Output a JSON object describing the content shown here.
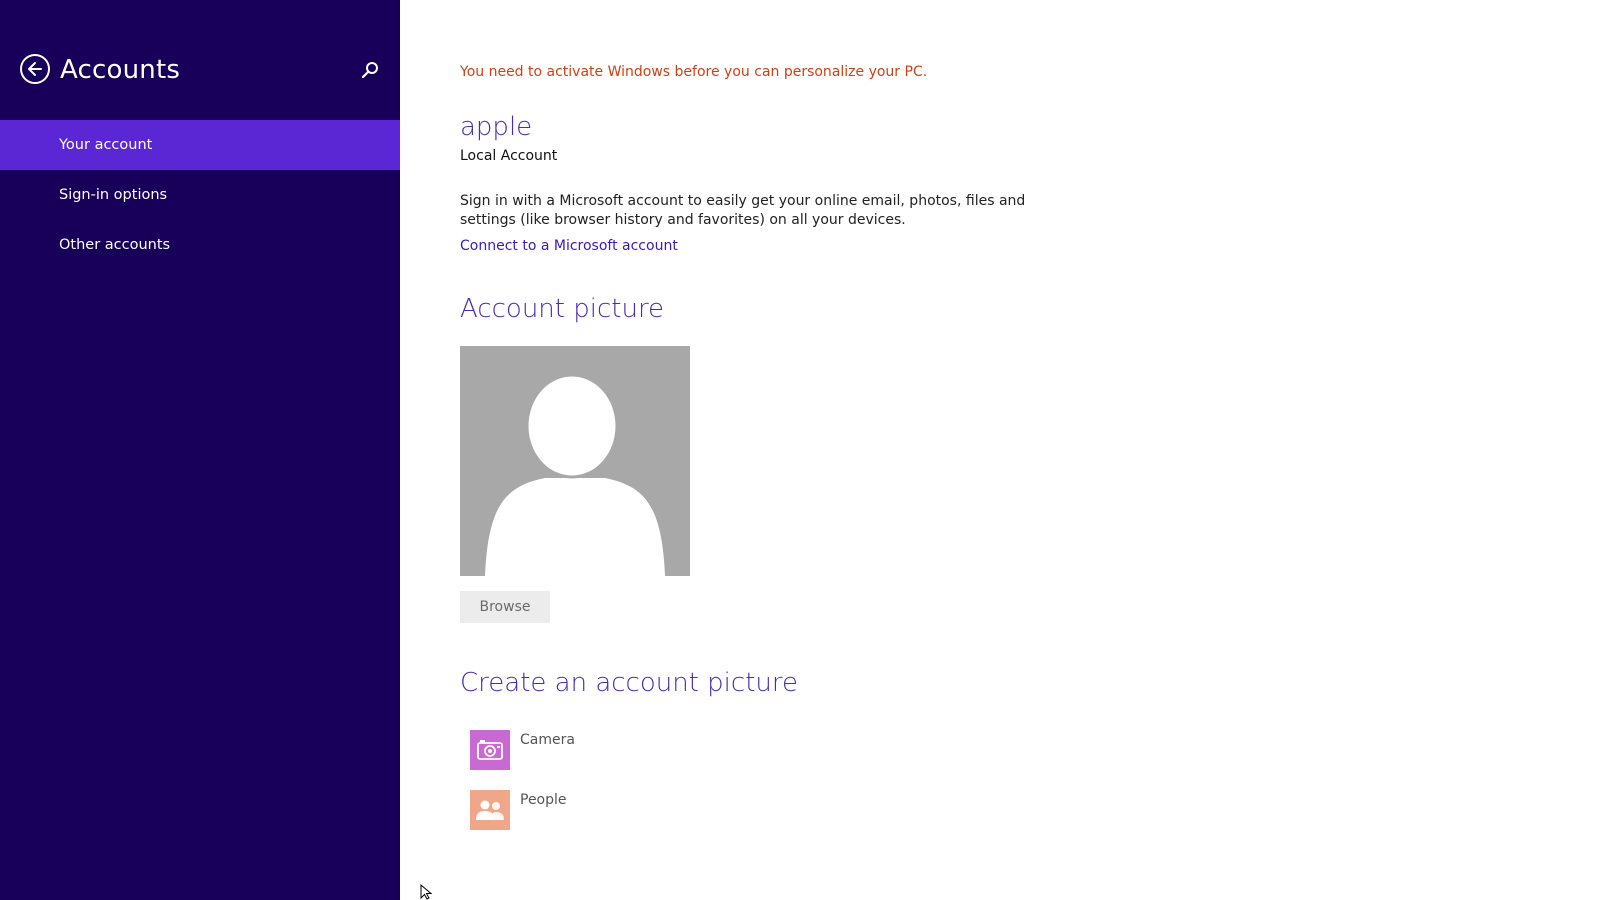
{
  "sidebar": {
    "title": "Accounts",
    "back_icon": "back-arrow-icon",
    "search_icon": "search-icon",
    "items": [
      {
        "label": "Your account",
        "active": true
      },
      {
        "label": "Sign-in options",
        "active": false
      },
      {
        "label": "Other accounts",
        "active": false
      }
    ]
  },
  "main": {
    "activation_notice": "You need to activate Windows before you can personalize your PC.",
    "user_name": "apple",
    "account_type": "Local Account",
    "signin_description": "Sign in with a Microsoft account to easily get your online email, photos, files and settings (like browser history and favorites) on all your devices.",
    "connect_link": "Connect to a Microsoft account",
    "account_picture": {
      "heading": "Account picture",
      "browse_label": "Browse"
    },
    "create_picture": {
      "heading": "Create an account picture",
      "options": [
        {
          "label": "Camera",
          "icon": "camera-icon"
        },
        {
          "label": "People",
          "icon": "people-icon"
        }
      ]
    }
  },
  "colors": {
    "sidebar_bg": "#18005a",
    "sidebar_active": "#5b27d5",
    "accent_text": "#4a2bb3",
    "warning_text": "#d13f14",
    "camera_tile": "#c86ad1",
    "people_tile": "#f0a789"
  }
}
